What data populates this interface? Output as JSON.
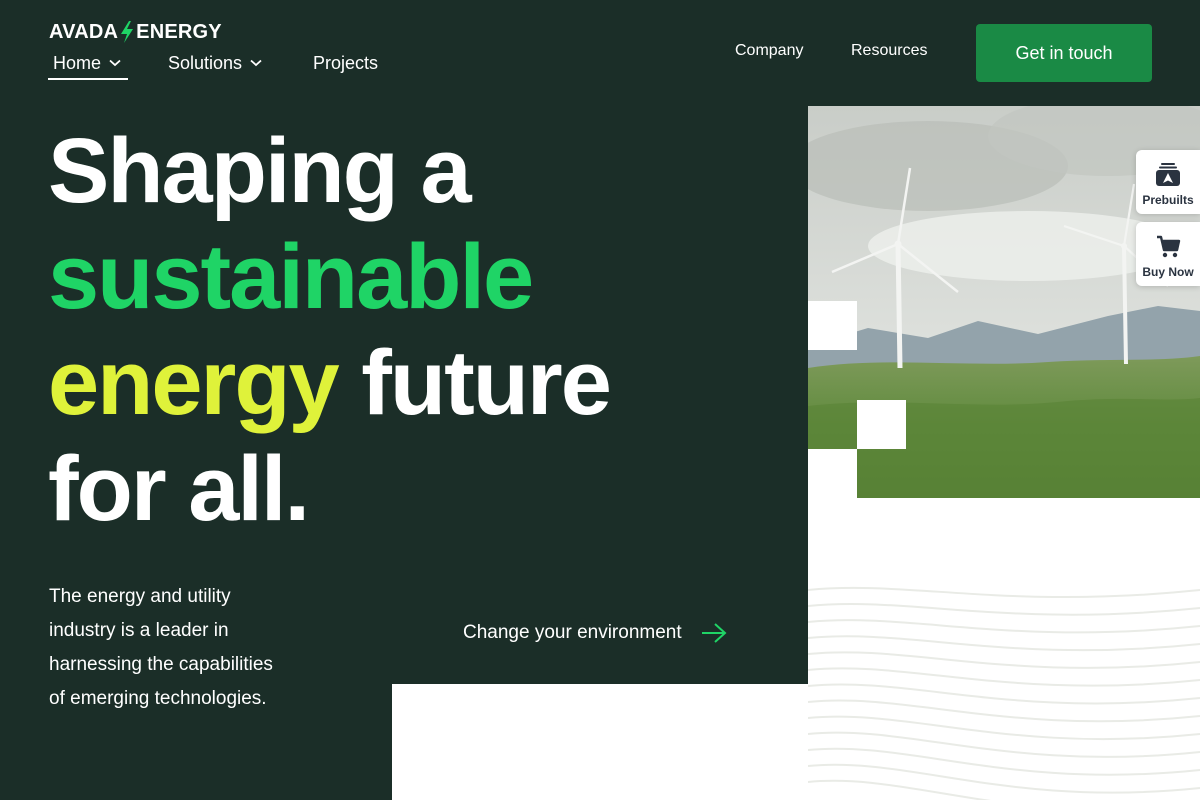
{
  "header": {
    "logo_left": "AVADA",
    "logo_right": "ENERGY",
    "nav": {
      "home": "Home",
      "solutions": "Solutions",
      "projects": "Projects",
      "company": "Company",
      "resources": "Resources"
    },
    "cta": "Get in touch"
  },
  "hero": {
    "line1": "Shaping a",
    "line2": "sustainable",
    "line3_accent": "energy",
    "line3_rest": "future",
    "line4": "for all.",
    "intro": "The energy and utility industry is a leader in harnessing the capabilities of emerging technologies.",
    "link": "Change your environment"
  },
  "side": {
    "prebuilts": "Prebuilts",
    "buy_now": "Buy Now"
  },
  "colors": {
    "dark_bg": "#1b2e28",
    "accent_green": "#1fd466",
    "accent_lime": "#dff23a",
    "button_green": "#1a8a45"
  },
  "icons": [
    "bolt-icon",
    "chevron-down-icon",
    "arrow-right-icon",
    "prebuilts-icon",
    "cart-icon"
  ]
}
